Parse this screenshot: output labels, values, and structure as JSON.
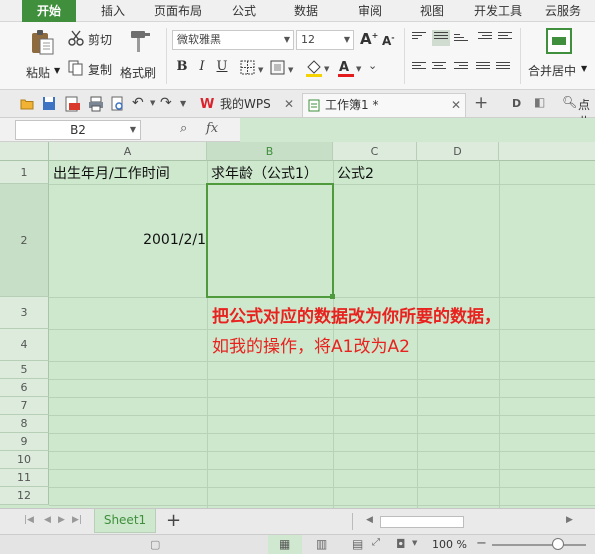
{
  "menu": {
    "tabs": [
      "开始",
      "插入",
      "页面布局",
      "公式",
      "数据",
      "审阅",
      "视图",
      "开发工具",
      "云服务"
    ],
    "active_index": 0
  },
  "ribbon": {
    "paste": "粘贴",
    "cut": "剪切",
    "copy": "复制",
    "format_painter": "格式刷",
    "font_name": "微软雅黑",
    "font_size": "12",
    "merge_center": "合并居中"
  },
  "doc_tabs": {
    "wps": "我的WPS",
    "workbook": "工作簿1 *",
    "right_hint": "点此"
  },
  "formula_bar": {
    "name_box": "B2",
    "fx": "fx"
  },
  "grid": {
    "columns": [
      "A",
      "B",
      "C",
      "D"
    ],
    "rows": [
      "1",
      "2",
      "3",
      "4",
      "5",
      "6",
      "7",
      "8",
      "9",
      "10",
      "11",
      "12"
    ],
    "cells": {
      "a1": "出生年月/工作时间",
      "b1": "求年龄（公式1）",
      "c1": "公式2",
      "a2": "2001/2/1"
    }
  },
  "annotation": {
    "line1": "把公式对应的数据改为你所要的数据，",
    "line2": "如我的操作，将A1改为A2"
  },
  "sheets": {
    "active": "Sheet1",
    "add": "+"
  },
  "status": {
    "zoom": "100 %"
  },
  "colors": {
    "accent": "#3f8f3c",
    "sheet_bg": "#cde8cd",
    "annotation": "#e8221f",
    "selection": "#4f9a3c"
  }
}
